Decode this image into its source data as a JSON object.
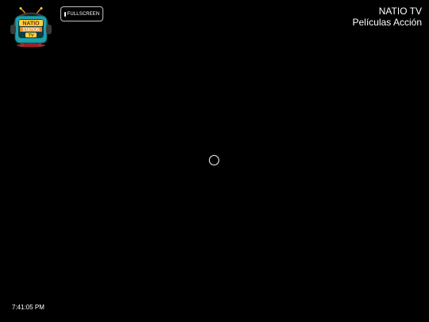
{
  "colors": {
    "background": "#000000",
    "text": "#ffffff",
    "button_border": "#bfbfbf",
    "logo_teal": "#1f9fa8",
    "logo_orange": "#f08a1c",
    "logo_yellow": "#ffd23a"
  },
  "logo": {
    "text_line1": "NATIO",
    "text_line2": "STATION",
    "text_line3": "TV",
    "icon": "retro-tv-logo"
  },
  "toolbar": {
    "fullscreen_label": "FULLSCREEN",
    "fullscreen_icon": "fullscreen-icon"
  },
  "channel": {
    "name": "NATIO TV",
    "program": "Películas Acción"
  },
  "player": {
    "loading_icon": "loading-spinner-icon"
  },
  "clock": {
    "time": "7:41:05 PM"
  }
}
